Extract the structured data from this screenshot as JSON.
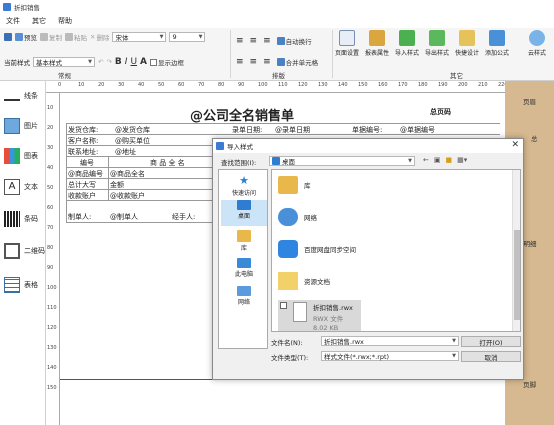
{
  "app": {
    "title": "折扣销售"
  },
  "menu": [
    "文件",
    "其它",
    "帮助"
  ],
  "toolbar": {
    "preview": "预览",
    "copy": "复制",
    "paste": "粘贴",
    "delete": "删除",
    "font": "宋体",
    "size": "9",
    "auto_wrap": "自动换行",
    "merge": "合并单元格",
    "show_border": "显示边框",
    "page_style_label": "当前样式",
    "page_style_value": "基本样式",
    "bold": "B",
    "italic": "I",
    "underline": "U",
    "font_color": "A",
    "group_common": "常规",
    "group_layout": "排版",
    "group_other": "其它",
    "big_buttons": [
      "页面设置",
      "报表属性",
      "导入样式",
      "导出样式",
      "快捷设计",
      "添加公式",
      "云样式"
    ]
  },
  "left_panel": [
    "线条",
    "图片",
    "图表",
    "文本",
    "条码",
    "二维码",
    "表格"
  ],
  "ruler": {
    "h": [
      "0",
      "10",
      "20",
      "30",
      "40",
      "50",
      "60",
      "70",
      "80",
      "90",
      "100",
      "110",
      "120",
      "130",
      "140",
      "150",
      "160",
      "170",
      "180",
      "190",
      "200",
      "210",
      "220",
      "23"
    ],
    "v": [
      "10",
      "20",
      "30",
      "40",
      "50",
      "60",
      "70",
      "80",
      "90",
      "100",
      "110",
      "120",
      "130",
      "140",
      "150"
    ]
  },
  "right_col": {
    "header": "页眉",
    "detail": "页明细",
    "footer": "页脚"
  },
  "report": {
    "title": "@公司全名销售单",
    "page_code": "总页码",
    "fields": {
      "warehouse_label": "发货仓库:",
      "warehouse_value": "@发货仓库",
      "date_label": "录单日期:",
      "date_value": "@录单日期",
      "order_no_label": "单据编号:",
      "order_no_value": "@单据编号",
      "client_label": "客户名称:",
      "client_value": "@购买单位",
      "contact_label": "联系地址:",
      "contact_value": "@地址",
      "col_no": "编号",
      "col_name": "商 品 全 名",
      "prod_no": "@商品编号",
      "prod_name": "@商品全名",
      "total_upper": "总计大写",
      "total_amount": "金额",
      "account_label": "收款账户",
      "account_value": "@收款账户",
      "maker_label": "制单人:",
      "maker_value": "@制单人",
      "handler_label": "经手人:"
    }
  },
  "dialog": {
    "title": "导入样式",
    "lookin_label": "查找范围(I):",
    "lookin_value": "桌面",
    "places": [
      "快速访问",
      "桌面",
      "库",
      "此电脑",
      "网络"
    ],
    "files": [
      {
        "name": "库",
        "kind": "library"
      },
      {
        "name": "网络",
        "kind": "network"
      },
      {
        "name": "百度网盘同步空间",
        "kind": "cloud"
      },
      {
        "name": "资源文档",
        "kind": "folder"
      }
    ],
    "selected_file": {
      "name": "折扣销售.rwx",
      "type": "RWX 文件",
      "size": "8.02 KB"
    },
    "filename_label": "文件名(N):",
    "filename_value": "折扣销售.rwx",
    "filetype_label": "文件类型(T):",
    "filetype_value": "样式文件(*.rwx;*.rpt)",
    "open_btn": "打开(O)",
    "cancel_btn": "取消"
  },
  "colors": {
    "accent": "#3b7bd4",
    "band": "#d6b990"
  }
}
